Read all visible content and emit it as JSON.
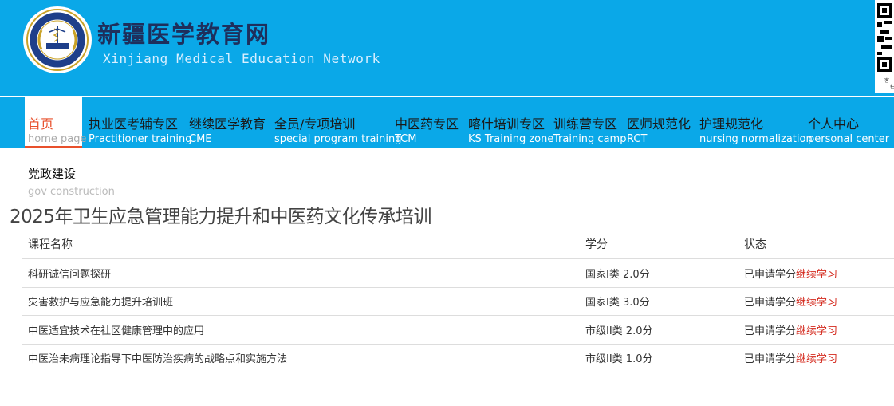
{
  "header": {
    "title": "新疆医学教育网",
    "subtitle": "Xinjiang Medical Education Network",
    "logo_text": "MEDICAL EDUCATION",
    "qr_caption_1": "客",
    "qr_caption_2": "扫"
  },
  "nav": [
    {
      "cn": "首页",
      "en": "home page",
      "active": true
    },
    {
      "cn": "执业医考辅专区",
      "en": "Practitioner training"
    },
    {
      "cn": "继续医学教育",
      "en": "CME"
    },
    {
      "cn": "全员/专项培训",
      "en": "special program training"
    },
    {
      "cn": "中医药专区",
      "en": "TCM"
    },
    {
      "cn": "喀什培训专区",
      "en": "KS Training zone"
    },
    {
      "cn": "训练营专区",
      "en": "Training camp"
    },
    {
      "cn": "医师规范化",
      "en": "RCT"
    },
    {
      "cn": "护理规范化",
      "en": "nursing normalization"
    },
    {
      "cn": "个人中心",
      "en": "personal center"
    }
  ],
  "second_nav": {
    "cn": "党政建设",
    "en": "gov construction"
  },
  "page_title": "2025年卫生应急管理能力提升和中医药文化传承培训",
  "table": {
    "headers": [
      "课程名称",
      "学分",
      "状态"
    ],
    "rows": [
      {
        "name": "科研诚信问题探研",
        "credit": "国家I类 2.0分",
        "status": "已申请学分",
        "action": "继续学习"
      },
      {
        "name": "灾害救护与应急能力提升培训班",
        "credit": "国家I类 3.0分",
        "status": "已申请学分",
        "action": "继续学习"
      },
      {
        "name": "中医适宜技术在社区健康管理中的应用",
        "credit": "市级II类 2.0分",
        "status": "已申请学分",
        "action": "继续学习"
      },
      {
        "name": "中医治未病理论指导下中医防治疾病的战略点和实施方法",
        "credit": "市级II类 1.0分",
        "status": "已申请学分",
        "action": "继续学习"
      }
    ]
  },
  "colors": {
    "header_bg": "#0aa8e8",
    "active": "#e8502c",
    "link": "#d42a1e"
  }
}
